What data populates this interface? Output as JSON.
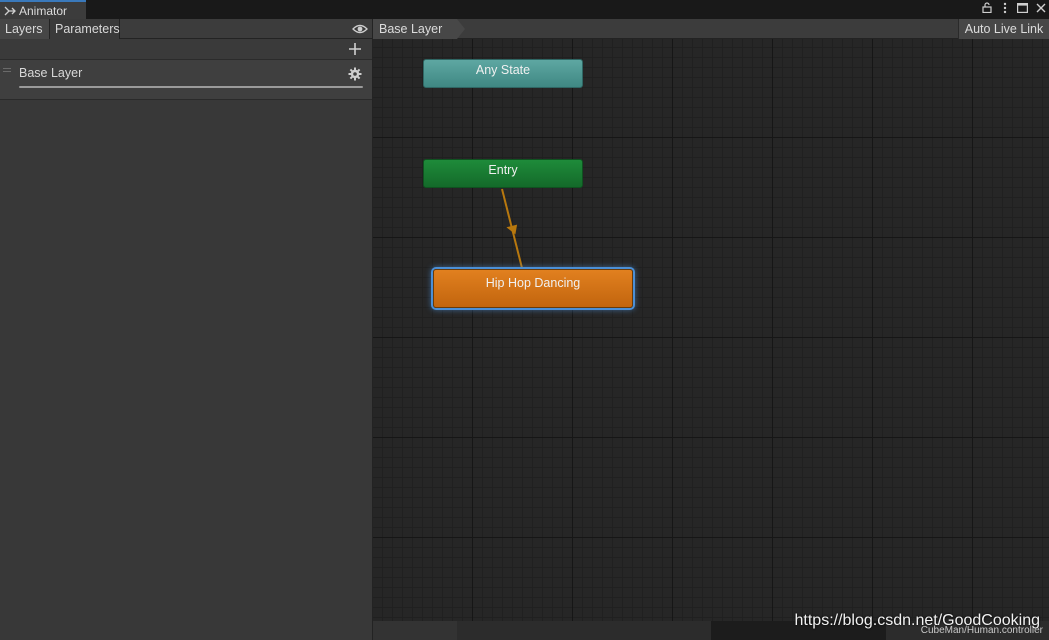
{
  "window": {
    "tab_title": "Animator",
    "controls": [
      "lock-icon",
      "more-icon",
      "maximize-icon",
      "close-icon"
    ]
  },
  "left_panel": {
    "tabs": [
      "Layers",
      "Parameters"
    ],
    "layers": [
      {
        "name": "Base Layer"
      }
    ]
  },
  "graph": {
    "breadcrumb": "Base Layer",
    "auto_live_link": "Auto Live Link",
    "nodes": {
      "any_state": "Any State",
      "entry": "Entry",
      "default_state": "Hip Hop Dancing"
    },
    "controller_path": "CubeMan/Human.controller"
  },
  "watermark": "https://blog.csdn.net/GoodCooking",
  "colors": {
    "any_state": "#4e9893",
    "entry": "#19792f",
    "default_state": "#d37519",
    "selection": "#4b8fd6",
    "transition": "#b8780e",
    "tab_accent": "#3a79bb"
  }
}
